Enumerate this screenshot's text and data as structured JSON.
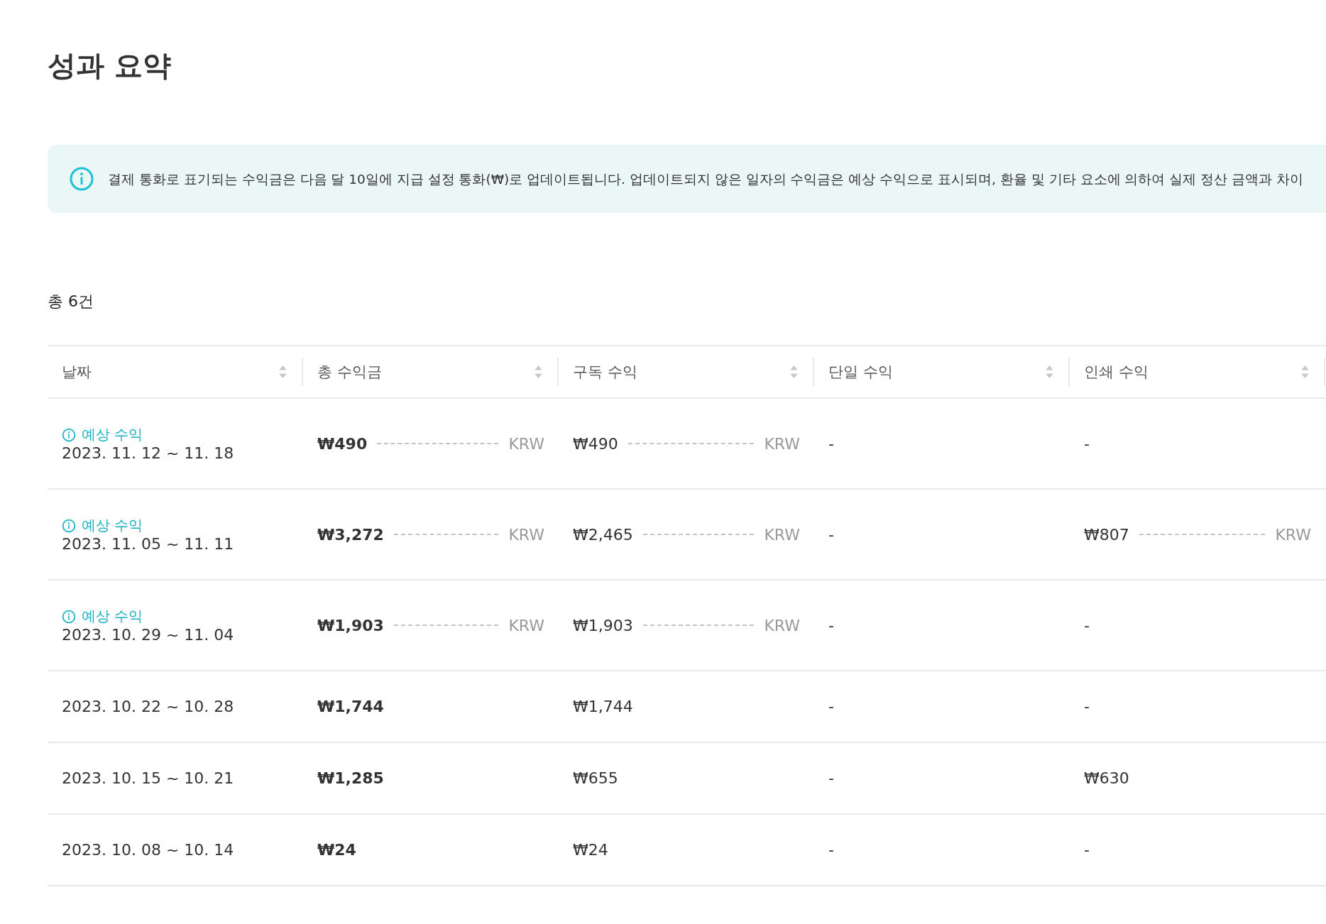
{
  "title": "성과 요약",
  "notice": {
    "text": "결제 통화로 표기되는 수익금은 다음 달 10일에 지급 설정 통화(₩)로 업데이트됩니다. 업데이트되지 않은 일자의 수익금은 예상 수익으로 표시되며, 환율 및 기타 요소에 의하여 실제 정산 금액과 차이"
  },
  "total_count": "총 6건",
  "table": {
    "columns": [
      "날짜",
      "총 수익금",
      "구독 수익",
      "단일 수익",
      "인쇄 수익"
    ],
    "rows": [
      {
        "cells": [
          {
            "kind": "date",
            "estimate": "예상 수익",
            "value": "2023. 11. 12 ~ 11. 18"
          },
          {
            "kind": "total",
            "value": "₩490",
            "currency": "KRW"
          },
          {
            "kind": "amount",
            "value": "₩490",
            "currency": "KRW"
          },
          {
            "kind": "amount",
            "value": "-"
          },
          {
            "kind": "amount",
            "value": "-"
          }
        ]
      },
      {
        "cells": [
          {
            "kind": "date",
            "estimate": "예상 수익",
            "value": "2023. 11. 05 ~ 11. 11"
          },
          {
            "kind": "total",
            "value": "₩3,272",
            "currency": "KRW"
          },
          {
            "kind": "amount",
            "value": "₩2,465",
            "currency": "KRW"
          },
          {
            "kind": "amount",
            "value": "-"
          },
          {
            "kind": "amount",
            "value": "₩807",
            "currency": "KRW"
          }
        ]
      },
      {
        "cells": [
          {
            "kind": "date",
            "estimate": "예상 수익",
            "value": "2023. 10. 29 ~ 11. 04"
          },
          {
            "kind": "total",
            "value": "₩1,903",
            "currency": "KRW"
          },
          {
            "kind": "amount",
            "value": "₩1,903",
            "currency": "KRW"
          },
          {
            "kind": "amount",
            "value": "-"
          },
          {
            "kind": "amount",
            "value": "-"
          }
        ]
      },
      {
        "cells": [
          {
            "kind": "date",
            "value": "2023. 10. 22 ~ 10. 28"
          },
          {
            "kind": "total",
            "value": "₩1,744"
          },
          {
            "kind": "amount",
            "value": "₩1,744"
          },
          {
            "kind": "amount",
            "value": "-"
          },
          {
            "kind": "amount",
            "value": "-"
          }
        ]
      },
      {
        "cells": [
          {
            "kind": "date",
            "value": "2023. 10. 15 ~ 10. 21"
          },
          {
            "kind": "total",
            "value": "₩1,285"
          },
          {
            "kind": "amount",
            "value": "₩655"
          },
          {
            "kind": "amount",
            "value": "-"
          },
          {
            "kind": "amount",
            "value": "₩630"
          }
        ]
      },
      {
        "cells": [
          {
            "kind": "date",
            "value": "2023. 10. 08 ~ 10. 14"
          },
          {
            "kind": "total",
            "value": "₩24"
          },
          {
            "kind": "amount",
            "value": "₩24"
          },
          {
            "kind": "amount",
            "value": "-"
          },
          {
            "kind": "amount",
            "value": "-"
          }
        ]
      }
    ]
  }
}
